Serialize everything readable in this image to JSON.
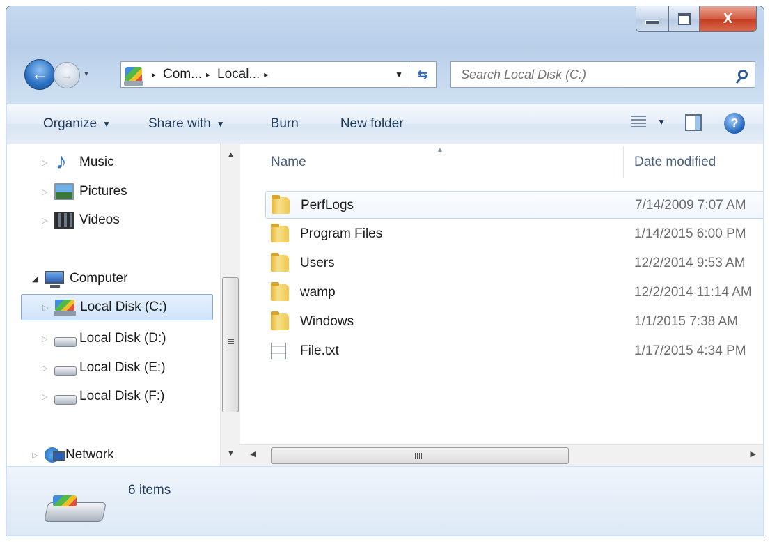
{
  "window": {
    "caption": {
      "minimize": "–",
      "maximize": "□",
      "close": "X"
    }
  },
  "nav": {
    "back_glyph": "←",
    "forward_glyph": "→",
    "history_dropdown": "▼",
    "address": {
      "crumbs": [
        "Com...",
        "Local..."
      ],
      "separator": "▸",
      "dropdown": "▼"
    },
    "refresh_glyph": "⇆",
    "search": {
      "placeholder": "Search Local Disk (C:)"
    }
  },
  "toolbar": {
    "organize": "Organize",
    "share_with": "Share with",
    "burn": "Burn",
    "new_folder": "New folder",
    "dropdown_arrow": "▼",
    "help": "?"
  },
  "sidebar": {
    "items": [
      {
        "label": "Music",
        "icon": "music-icon"
      },
      {
        "label": "Pictures",
        "icon": "pictures-icon"
      },
      {
        "label": "Videos",
        "icon": "videos-icon"
      },
      {
        "label": "Computer",
        "icon": "computer-icon"
      },
      {
        "label": "Local Disk (C:)",
        "icon": "os-drive-icon",
        "selected": true
      },
      {
        "label": "Local Disk (D:)",
        "icon": "drive-icon"
      },
      {
        "label": "Local Disk (E:)",
        "icon": "drive-icon"
      },
      {
        "label": "Local Disk (F:)",
        "icon": "drive-icon"
      },
      {
        "label": "Network",
        "icon": "network-icon"
      }
    ],
    "collapsed_glyph": "▷",
    "expanded_glyph": "◢"
  },
  "files": {
    "columns": {
      "name": "Name",
      "date": "Date modified"
    },
    "sort_caret": "▲",
    "rows": [
      {
        "name": "PerfLogs",
        "date": "7/14/2009 7:07 AM",
        "type": "folder"
      },
      {
        "name": "Program Files",
        "date": "1/14/2015 6:00 PM",
        "type": "folder"
      },
      {
        "name": "Users",
        "date": "12/2/2014 9:53 AM",
        "type": "folder"
      },
      {
        "name": "wamp",
        "date": "12/2/2014 11:14 AM",
        "type": "folder"
      },
      {
        "name": "Windows",
        "date": "1/1/2015 7:38 AM",
        "type": "folder"
      },
      {
        "name": "File.txt",
        "date": "1/17/2015 4:34 PM",
        "type": "text"
      }
    ]
  },
  "scroll": {
    "up": "▲",
    "down": "▼",
    "left": "◀",
    "right": "▶"
  },
  "details": {
    "item_count": "6 items"
  },
  "colors": {
    "chrome": "#c5d9ef",
    "toolbar_text": "#1e395b",
    "selection": "#cfe4fa",
    "folder": "#f0c84e"
  }
}
